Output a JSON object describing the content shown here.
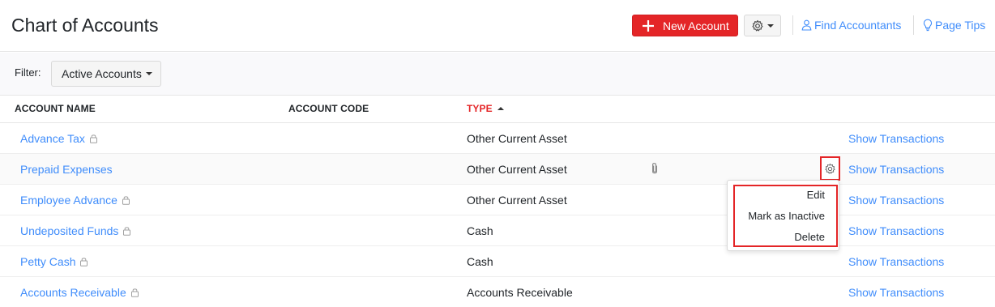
{
  "header": {
    "title": "Chart of Accounts",
    "new_account_label": "New Account",
    "find_accountants_label": "Find Accountants",
    "page_tips_label": "Page Tips"
  },
  "filter": {
    "label": "Filter:",
    "selected": "Active Accounts"
  },
  "columns": {
    "account_name": "ACCOUNT NAME",
    "account_code": "ACCOUNT CODE",
    "type": "TYPE"
  },
  "rows": [
    {
      "name": "Advance Tax",
      "locked": true,
      "type": "Other Current Asset",
      "action": "Show Transactions"
    },
    {
      "name": "Prepaid Expenses",
      "locked": false,
      "type": "Other Current Asset",
      "action": "Show Transactions"
    },
    {
      "name": "Employee Advance",
      "locked": true,
      "type": "Other Current Asset",
      "action": "Show Transactions"
    },
    {
      "name": "Undeposited Funds",
      "locked": true,
      "type": "Cash",
      "action": "Show Transactions"
    },
    {
      "name": "Petty Cash",
      "locked": true,
      "type": "Cash",
      "action": "Show Transactions"
    },
    {
      "name": "Accounts Receivable",
      "locked": true,
      "type": "Accounts Receivable",
      "action": "Show Transactions"
    }
  ],
  "menu": {
    "edit": "Edit",
    "mark_inactive": "Mark as Inactive",
    "delete": "Delete"
  },
  "colors": {
    "brand_red": "#e42527",
    "link_blue": "#408dfb",
    "highlight_border": "#e42527"
  },
  "icons": {
    "plus": "plus-icon",
    "gear": "gear-icon",
    "person": "person-icon",
    "bulb": "lightbulb-icon",
    "lock": "lock-icon",
    "clip": "paperclip-icon"
  }
}
